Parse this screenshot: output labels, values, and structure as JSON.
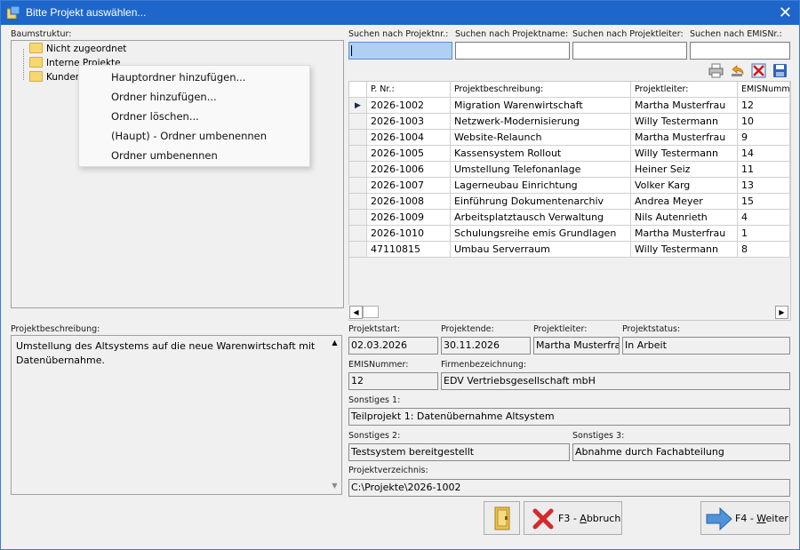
{
  "window": {
    "title": "Bitte Projekt auswählen...",
    "close_glyph": "✕"
  },
  "tree": {
    "label": "Baumstruktur:",
    "items": [
      "Nicht zugeordnet",
      "Interne Projekte",
      "Kunden"
    ]
  },
  "context_menu": {
    "items": [
      "Hauptordner hinzufügen...",
      "Ordner hinzufügen...",
      "Ordner löschen...",
      "(Haupt) - Ordner umbenennen",
      "Ordner umbenennen"
    ]
  },
  "search": {
    "projektnr_label": "Suchen nach Projektnr.:",
    "projektname_label": "Suchen nach Projektname:",
    "projektleiter_label": "Suchen nach Projektleiter:",
    "emisnr_label": "Suchen nach EMISNr.:"
  },
  "toolbar": {
    "icons": [
      "printer-icon",
      "undo-icon",
      "delete-icon",
      "save-icon"
    ]
  },
  "table": {
    "columns": [
      "P. Nr.:",
      "Projektbeschreibung:",
      "Projektleiter:",
      "EMISNumm"
    ],
    "rows": [
      [
        "2026-1002",
        "Migration Warenwirtschaft",
        "Martha Musterfrau",
        "12"
      ],
      [
        "2026-1003",
        "Netzwerk-Modernisierung",
        "Willy Testermann",
        "10"
      ],
      [
        "2026-1004",
        "Website-Relaunch",
        "Martha Musterfrau",
        "9"
      ],
      [
        "2026-1005",
        "Kassensystem Rollout",
        "Willy Testermann",
        "14"
      ],
      [
        "2026-1006",
        "Umstellung Telefonanlage",
        "Heiner Seiz",
        "11"
      ],
      [
        "2026-1007",
        "Lagerneubau Einrichtung",
        "Volker Karg",
        "13"
      ],
      [
        "2026-1008",
        "Einführung Dokumentenarchiv",
        "Andrea Meyer",
        "15"
      ],
      [
        "2026-1009",
        "Arbeitsplatztausch Verwaltung",
        "Nils Autenrieth",
        "4"
      ],
      [
        "2026-1010",
        "Schulungsreihe emis Grundlagen",
        "Martha Musterfrau",
        "1"
      ],
      [
        "47110815",
        "Umbau Serverraum",
        "Willy Testermann",
        "8"
      ]
    ],
    "selected_row_index": 0
  },
  "details": {
    "desc_label": "Projektbeschreibung:",
    "desc_text": "Umstellung des Altsystems auf die neue Warenwirtschaft mit Datenübernahme.",
    "start_label": "Projektstart:",
    "start_value": "02.03.2026",
    "end_label": "Projektende:",
    "end_value": "30.11.2026",
    "leiter_label": "Projektleiter:",
    "leiter_value": "Martha Musterfrau",
    "status_label": "Projektstatus:",
    "status_value": "In Arbeit",
    "emis_label": "EMISNummer:",
    "emis_value": "12",
    "firma_label": "Firmenbezeichnung:",
    "firma_value": "EDV Vertriebsgesellschaft mbH",
    "s1_label": "Sonstiges 1:",
    "s1_value": "Teilprojekt 1: Datenübernahme Altsystem",
    "s2_label": "Sonstiges 2:",
    "s2_value": "Testsystem bereitgestellt",
    "s3_label": "Sonstiges 3:",
    "s3_value": "Abnahme durch Fachabteilung",
    "dir_label": "Projektverzeichnis:",
    "dir_value": "C:\\Projekte\\2026-1002"
  },
  "buttons": {
    "cancel_prefix": "F3 - ",
    "cancel_mnemonic": "A",
    "cancel_rest": "bbruch",
    "next_prefix": "F4 - ",
    "next_mnemonic": "W",
    "next_rest": "eiter"
  },
  "colors": {
    "titlebar": "#1e66c9",
    "search_active": "#aed0f2"
  }
}
